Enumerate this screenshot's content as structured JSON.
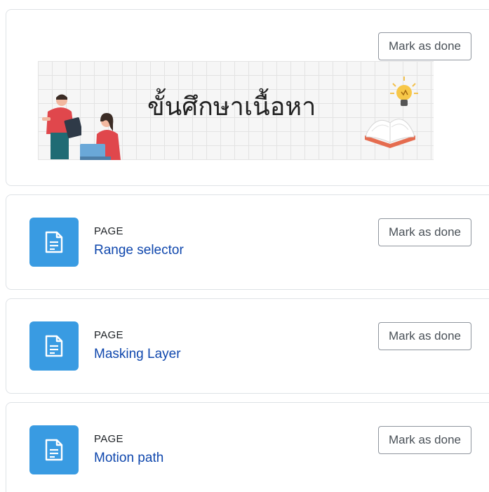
{
  "banner_section": {
    "mark_done_label": "Mark as done",
    "banner_title": "ขั้นศึกษาเนื้อหา"
  },
  "activities": [
    {
      "type": "PAGE",
      "name": "Range selector",
      "mark_done_label": "Mark as done"
    },
    {
      "type": "PAGE",
      "name": "Masking Layer",
      "mark_done_label": "Mark as done"
    },
    {
      "type": "PAGE",
      "name": "Motion path",
      "mark_done_label": "Mark as done"
    }
  ],
  "icons": {
    "activity_icon": "page-document-icon",
    "banner_art": [
      "teacher-illustration",
      "student-laptop-illustration",
      "lightbulb-illustration",
      "open-book-illustration"
    ]
  },
  "colors": {
    "icon_bg": "#399be2",
    "link": "#0f47ad",
    "border": "#dee2e6"
  }
}
